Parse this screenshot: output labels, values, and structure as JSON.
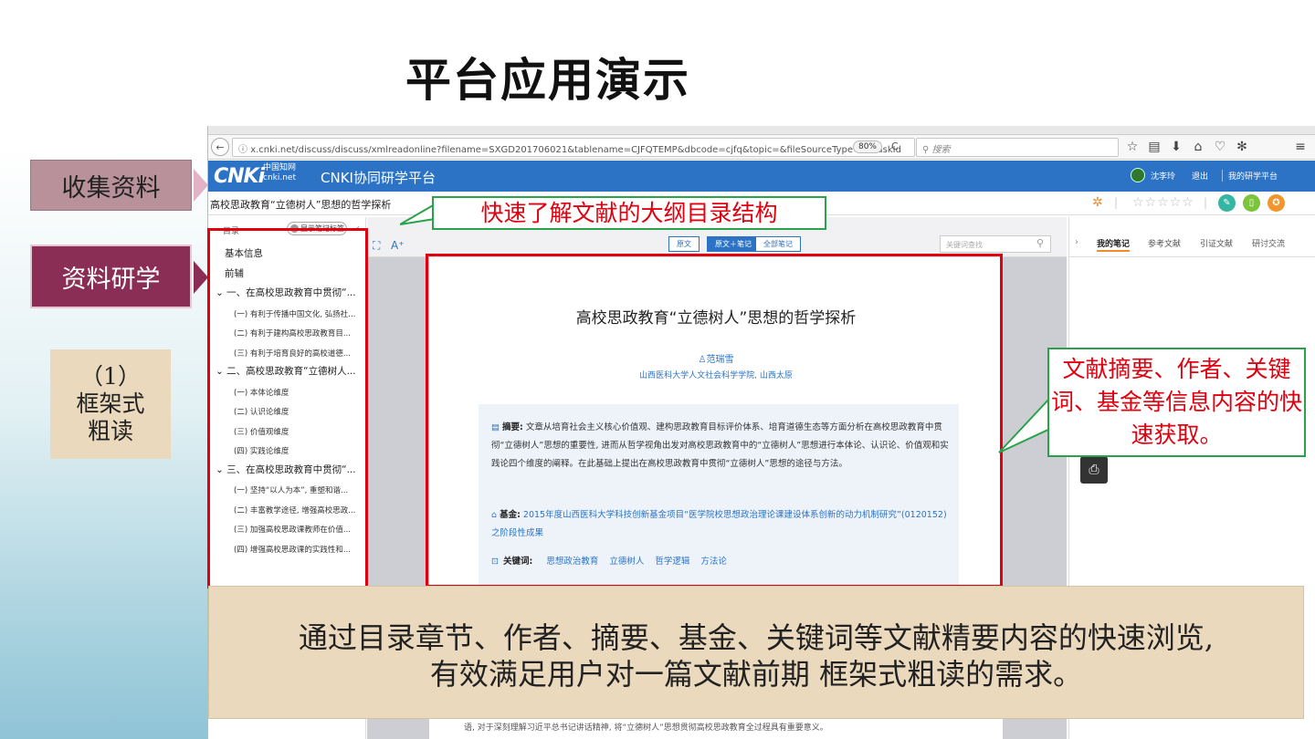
{
  "slide": {
    "title": "平台应用演示",
    "labels": {
      "collect": "收集资料",
      "research": "资料研学",
      "framework_line1": "（1）",
      "framework_line2": "框架式",
      "framework_line3": "粗读"
    },
    "callouts": {
      "toc": "快速了解文献的大纲目录结构",
      "abstract": "文献摘要、作者、关键词、基金等信息内容的快速获取。"
    },
    "summary": {
      "line1": "通过目录章节、作者、摘要、基金、关键词等文献精要内容的快速浏览,",
      "line2": "有效满足用户对一篇文献前期 框架式粗读的需求。"
    },
    "colors": {
      "red": "#e0000f",
      "green": "#2aa24a",
      "beige": "#ead9bd",
      "maroon": "#8a2e56",
      "cnki_blue": "#2c73c5"
    }
  },
  "browser": {
    "url": "x.cnki.net/discuss/discuss/xmlreadonline?filename=SXGD201706021&tablename=CJFQTEMP&dbcode=cjfq&topic=&fileSourceType=1&taskId",
    "zoom": "80%",
    "search_placeholder": "搜索",
    "icons": [
      "back-icon",
      "info-icon",
      "reload-icon",
      "star-icon",
      "reading-list-icon",
      "download-icon",
      "home-icon",
      "pocket-icon",
      "extension-icon",
      "menu-icon"
    ]
  },
  "app": {
    "logo": "CNKi",
    "logo_cn": "中国知网",
    "logo_domain": "cnki.net",
    "title": "CNKI协同研学平台",
    "user": "沈李玲",
    "logout": "退出",
    "my_platform": "我的研学平台",
    "doc_title": "高校思政教育“立德树人”思想的哲学探析",
    "stars": "☆☆☆☆☆"
  },
  "toc": {
    "label": "目录",
    "toggle": "显示笔记标签",
    "items": [
      {
        "text": "基本信息",
        "level": "top"
      },
      {
        "text": "前辅",
        "level": "top"
      },
      {
        "text": "⌄ 一、在高校思政教育中贯彻“...",
        "level": "sec"
      },
      {
        "text": "(一) 有利于传播中国文化, 弘扬社...",
        "level": "sub"
      },
      {
        "text": "(二) 有利于建构高校思政教育目...",
        "level": "sub"
      },
      {
        "text": "(三) 有利于培育良好的高校道德...",
        "level": "sub"
      },
      {
        "text": "⌄ 二、高校思政教育“立德树人...",
        "level": "sec"
      },
      {
        "text": "(一) 本体论维度",
        "level": "sub"
      },
      {
        "text": "(二) 认识论维度",
        "level": "sub"
      },
      {
        "text": "(三) 价值观维度",
        "level": "sub"
      },
      {
        "text": "(四) 实践论维度",
        "level": "sub"
      },
      {
        "text": "⌄ 三、在高校思政教育中贯彻“...",
        "level": "sec"
      },
      {
        "text": "(一) 坚持“以人为本”, 重塑和谐...",
        "level": "sub"
      },
      {
        "text": "(二) 丰富教学途径, 增强高校思政...",
        "level": "sub"
      },
      {
        "text": "(三) 加强高校思政课教师在价值...",
        "level": "sub"
      },
      {
        "text": "(四) 增强高校思政课的实践性和...",
        "level": "sub"
      }
    ]
  },
  "reader": {
    "modes": [
      "原文",
      "原文＋笔记",
      "全部笔记"
    ],
    "keyword_search": "关键词查找",
    "paper_title": "高校思政教育“立德树人”思想的哲学探析",
    "author": "范瑞雪",
    "affiliation": "山西医科大学人文社会科学学院, 山西太原",
    "abstract_label": "摘要:",
    "abstract": "文章从培育社会主义核心价值观、建构思政教育目标评价体系、培育道德生态等方面分析在高校思政教育中贯彻“立德树人”思想的重要性, 进而从哲学视角出发对高校思政教育中的“立德树人”思想进行本体论、认识论、价值观和实践论四个维度的阐释。在此基础上提出在高校思政教育中贯彻“立德树人”思想的途径与方法。",
    "fund_label": "基金:",
    "fund": "2015年度山西医科大学科技创新基金项目“医学院校思想政治理论课建设体系创新的动力机制研究”(0120152) 之阶段性成果",
    "keywords_label": "关键词:",
    "keywords": [
      "思想政治教育",
      "立德树人",
      "哲学逻辑",
      "方法论"
    ],
    "spill": "语, 对于深刻理解习近平总书记讲话精神, 将“立德树人”思想贯彻高校思政教育全过程具有重要意义。"
  },
  "notes_panel": {
    "tabs": [
      "我的笔记",
      "参考文献",
      "引证文献",
      "研讨交流"
    ]
  }
}
